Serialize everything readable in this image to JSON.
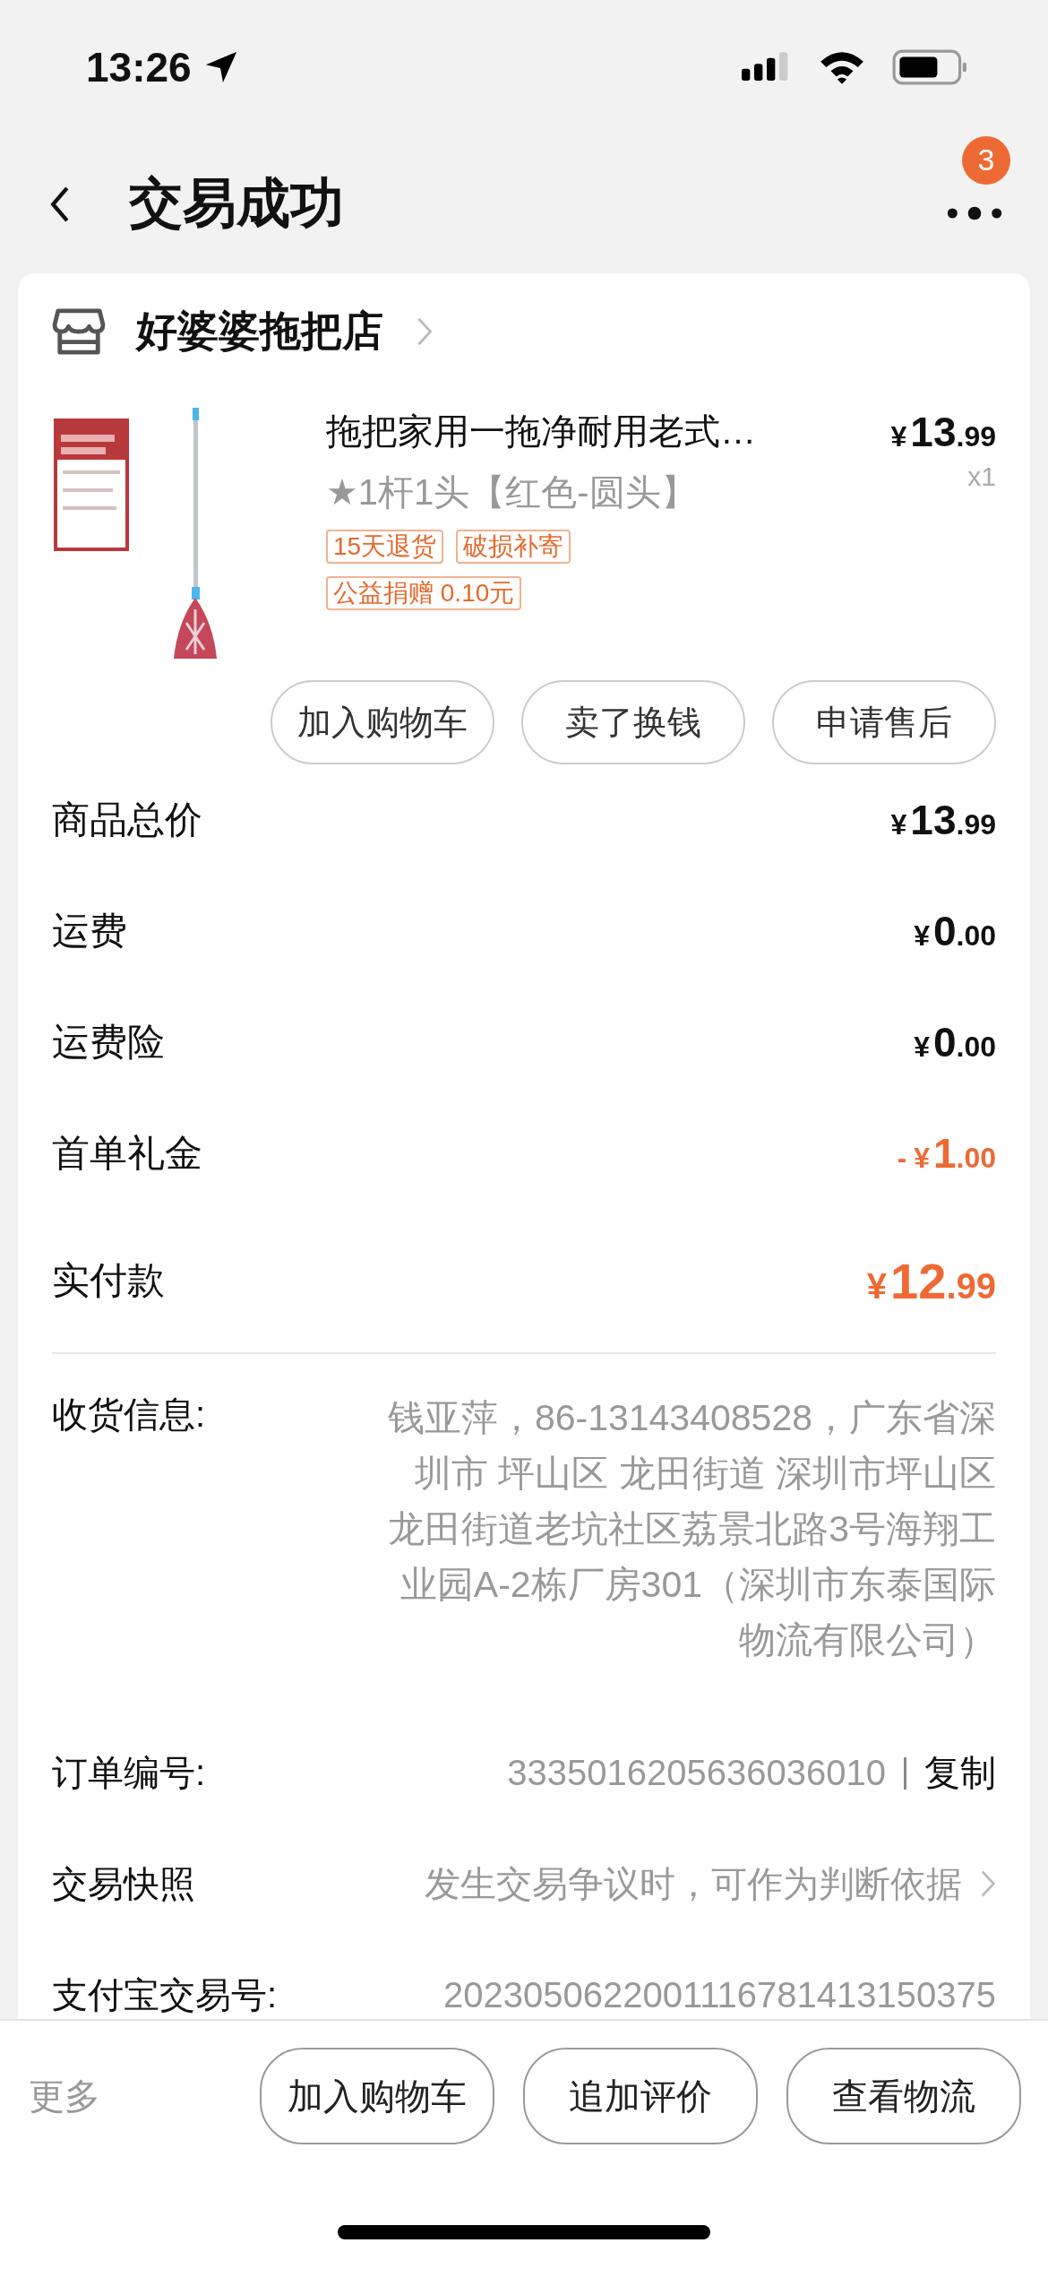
{
  "status_bar": {
    "time": "13:26"
  },
  "nav": {
    "title": "交易成功",
    "badge": "3"
  },
  "shop": {
    "name": "好婆婆拖把店"
  },
  "product": {
    "title": "拖把家用一拖净耐用老式…",
    "sku": "★1杆1头【红色-圆头】",
    "price": {
      "yen": "¥",
      "whole": "13",
      "fraction": ".99"
    },
    "quantity": "x1",
    "tags": [
      "15天退货",
      "破损补寄",
      "公益捐赠 0.10元"
    ]
  },
  "product_actions": [
    "加入购物车",
    "卖了换钱",
    "申请售后"
  ],
  "summary": [
    {
      "label": "商品总价",
      "kind": "normal",
      "amount": {
        "yen": "¥",
        "whole": "13",
        "fraction": ".99"
      }
    },
    {
      "label": "运费",
      "kind": "normal",
      "amount": {
        "yen": "¥",
        "whole": "0",
        "fraction": ".00"
      }
    },
    {
      "label": "运费险",
      "kind": "normal",
      "amount": {
        "yen": "¥",
        "whole": "0",
        "fraction": ".00"
      }
    },
    {
      "label": "首单礼金",
      "kind": "discount",
      "amount": {
        "prefix": "-",
        "yen": "¥",
        "whole": "1",
        "fraction": ".00"
      }
    },
    {
      "label": "实付款",
      "kind": "total",
      "amount": {
        "yen": "¥",
        "whole": "12",
        "fraction": ".99"
      }
    }
  ],
  "details": [
    {
      "label": "收货信息:",
      "kind": "address",
      "value": "钱亚萍，86-13143408528，广东省深圳市 坪山区 龙田街道 深圳市坪山区龙田街道老坑社区荔景北路3号海翔工业园A-2栋厂房301（深圳市东泰国际物流有限公司）"
    },
    {
      "label": "订单编号:",
      "kind": "copy",
      "value": "3335016205636036010",
      "action": "复制"
    },
    {
      "label": "交易快照",
      "kind": "link",
      "value": "发生交易争议时，可作为判断依据"
    },
    {
      "label": "支付宝交易号:",
      "kind": "plain",
      "value": "2023050622001116781413150375"
    }
  ],
  "bottom_bar": {
    "more": "更多",
    "buttons": [
      "加入购物车",
      "追加评价",
      "查看物流"
    ]
  }
}
